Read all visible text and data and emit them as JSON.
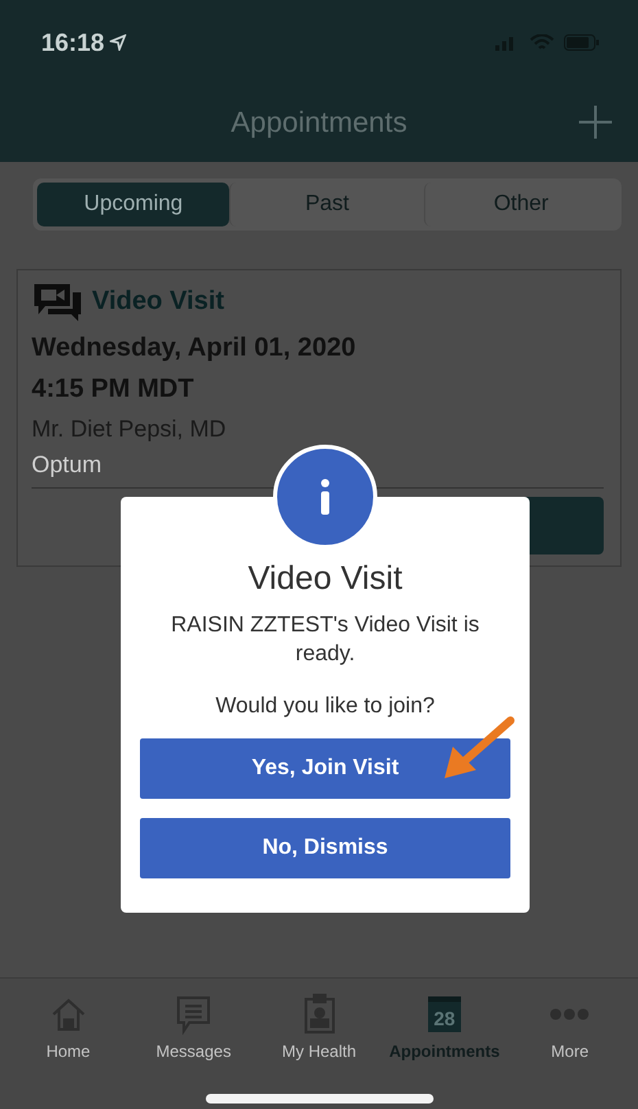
{
  "status_bar": {
    "time": "16:18"
  },
  "header": {
    "title": "Appointments"
  },
  "segments": [
    {
      "label": "Upcoming",
      "selected": true
    },
    {
      "label": "Past",
      "selected": false
    },
    {
      "label": "Other",
      "selected": false
    }
  ],
  "appointment": {
    "type": "Video Visit",
    "date": "Wednesday, April 01, 2020",
    "time": "4:15 PM MDT",
    "provider": "Mr. Diet Pepsi, MD",
    "organization": "Optum"
  },
  "dialog": {
    "title": "Video Visit",
    "message": "RAISIN ZZTEST's Video Visit is ready.",
    "question": "Would you like to join?",
    "buttons": [
      "Yes, Join Visit",
      "No, Dismiss"
    ]
  },
  "tab_bar": [
    {
      "label": "Home",
      "selected": false
    },
    {
      "label": "Messages",
      "selected": false
    },
    {
      "label": "My Health",
      "selected": false
    },
    {
      "label": "Appointments",
      "badge": "28",
      "selected": true
    },
    {
      "label": "More",
      "selected": false
    }
  ]
}
